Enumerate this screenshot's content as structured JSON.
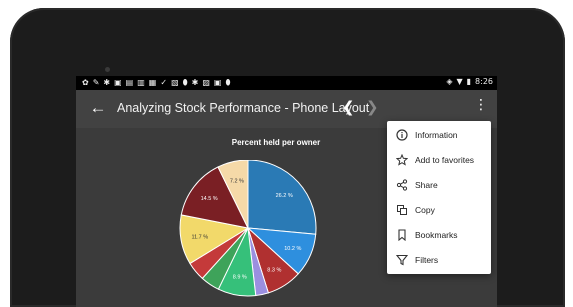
{
  "status_bar": {
    "icons": [
      "notif-icons"
    ],
    "time": "8:26"
  },
  "toolbar": {
    "title": "Analyzing Stock Performance - Phone Layout"
  },
  "menu": {
    "items": [
      {
        "label": "Information",
        "icon": "info-icon"
      },
      {
        "label": "Add to favorites",
        "icon": "star-icon"
      },
      {
        "label": "Share",
        "icon": "share-icon"
      },
      {
        "label": "Copy",
        "icon": "copy-icon"
      },
      {
        "label": "Bookmarks",
        "icon": "bookmark-icon"
      },
      {
        "label": "Filters",
        "icon": "filter-icon"
      }
    ]
  },
  "chart_data": {
    "type": "pie",
    "title": "Percent held per owner",
    "slices": [
      {
        "label": "26.2 %",
        "value": 26.2,
        "color": "#2a7ab5"
      },
      {
        "label": "10.2 %",
        "value": 10.2,
        "color": "#2e8fde"
      },
      {
        "label": "8.3 %",
        "value": 8.3,
        "color": "#b03030"
      },
      {
        "label": "",
        "value": 3.0,
        "color": "#9b8fe0"
      },
      {
        "label": "8.9 %",
        "value": 8.9,
        "color": "#36c07a"
      },
      {
        "label": "",
        "value": 4.5,
        "color": "#3ea35a"
      },
      {
        "label": "",
        "value": 4.5,
        "color": "#c43a3a"
      },
      {
        "label": "11.7 %",
        "value": 11.7,
        "color": "#f2d96a"
      },
      {
        "label": "14.5 %",
        "value": 14.5,
        "color": "#7a1f24"
      },
      {
        "label": "7.2 %",
        "value": 7.2,
        "color": "#f5d9a8"
      }
    ]
  }
}
